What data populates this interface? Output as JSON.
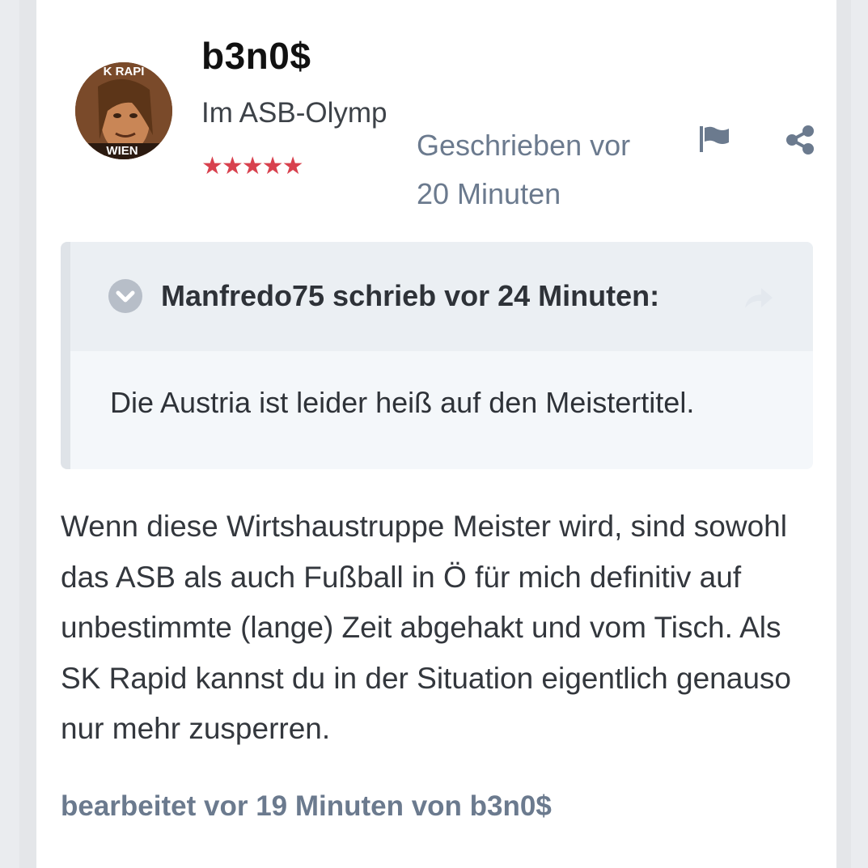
{
  "author": {
    "name": "b3n0$",
    "group": "Im ASB-Olymp",
    "stars": "★★★★★",
    "avatar_text_top": "K RAPI",
    "avatar_text_bottom": "WIEN"
  },
  "post": {
    "time": "Geschrieben vor 20 Minuten",
    "content": "Wenn diese Wirtshaustruppe Meister wird, sind sowohl das ASB als auch Fußball in Ö für mich definitiv auf unbestimmte (lange) Zeit abgehakt und vom Tisch. Als SK Rapid kannst du in der Situation eigentlich genauso nur mehr zusperren.",
    "edit_note": "bearbeitet vor 19 Minuten von b3n0$"
  },
  "quote": {
    "citation": "Manfredo75 schrieb vor 24 Minuten:",
    "text": "Die Austria ist leider heiß auf den Meistertitel."
  },
  "icons": {
    "flag": "flag-icon",
    "share": "share-icon",
    "toggle": "chevron-down-circle-icon",
    "jump": "share-arrow-icon"
  },
  "colors": {
    "meta_text": "#6b7a8e",
    "stars": "#d8414e",
    "quote_bg": "#f4f7fa",
    "quote_header_bg": "#ebeff3"
  }
}
